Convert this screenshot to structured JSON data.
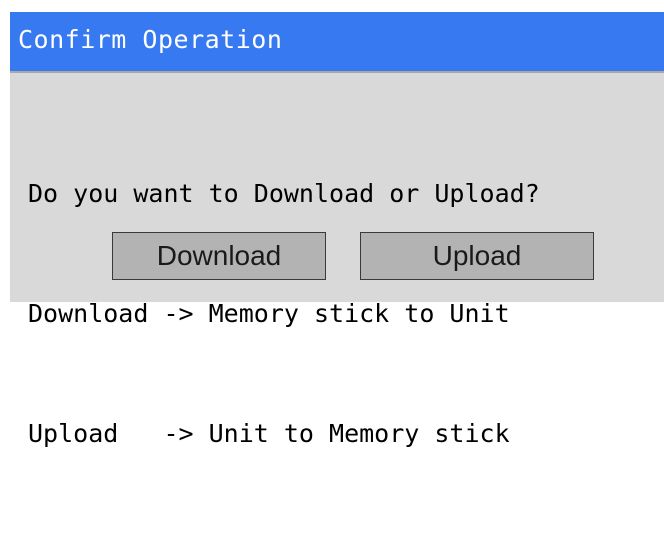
{
  "dialog": {
    "title": "Confirm Operation",
    "message_lines": [
      "Do you want to Download or Upload?",
      "Download -> Memory stick to Unit",
      "Upload   -> Unit to Memory stick"
    ],
    "buttons": {
      "download_label": "Download",
      "upload_label": "Upload"
    }
  },
  "colors": {
    "title_bar": "#3779f1",
    "dialog_background": "#d9d9d9",
    "button_background": "#b3b3b3"
  }
}
